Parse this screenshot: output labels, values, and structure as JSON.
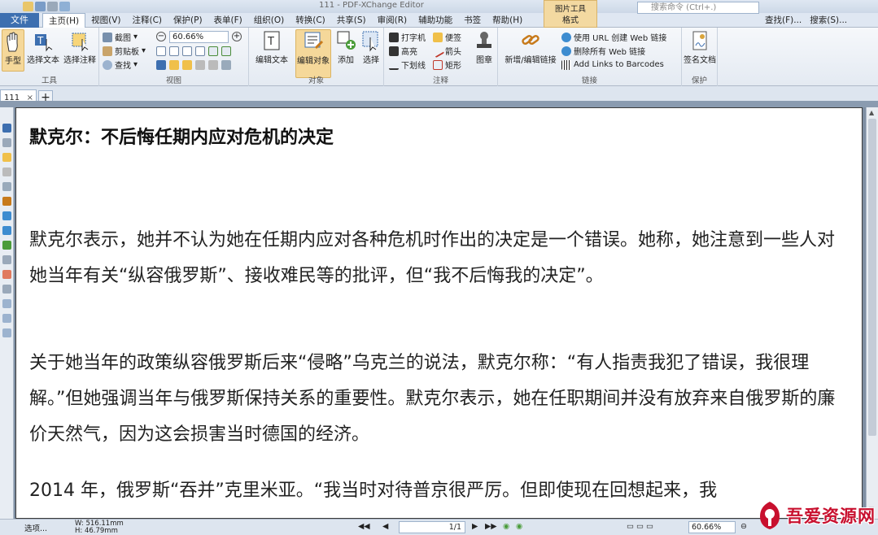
{
  "window": {
    "title": "111 - PDF-XChange Editor"
  },
  "menu": {
    "file": "文件",
    "items": [
      "主页(H)",
      "视图(V)",
      "注释(C)",
      "保护(P)",
      "表单(F)",
      "组织(O)",
      "转换(C)",
      "共享(S)",
      "审阅(R)",
      "辅助功能",
      "书签",
      "帮助(H)"
    ],
    "format_tab_top": "图片工具",
    "format_tab": "格式",
    "search_placeholder": "搜索命令 (Ctrl+.)",
    "right_tools": [
      "查找(F)...",
      "搜索(S)..."
    ]
  },
  "ribbon": {
    "tools_group": {
      "label": "工具",
      "hand": "手型",
      "select_text": "选择文本",
      "select_note": "选择注释"
    },
    "view_group": {
      "label": "视图",
      "snapshot": "截图",
      "clipboard": "剪贴板",
      "find": "查找",
      "zoom": "60.66%"
    },
    "objects_group": {
      "label": "对象",
      "edit_text": "编辑文本",
      "edit_objects": "编辑对象",
      "add": "添加",
      "select": "选择"
    },
    "comments_group": {
      "label": "注释",
      "typewriter": "打字机",
      "sticky": "便签",
      "highlight": "高亮",
      "arrow": "箭头",
      "underline": "下划线",
      "rectangle": "矩形",
      "stamp": "图章"
    },
    "links_group": {
      "label": "链接",
      "new_link": "新增/编辑链接",
      "url_to_links": "使用 URL 创建 Web 链接",
      "remove_links": "删除所有 Web 链接",
      "barcodes": "Add Links to Barcodes"
    },
    "protect_group": {
      "label": "保护",
      "sign": "签名文档"
    }
  },
  "tabs": {
    "doc_name": "111",
    "close": "×",
    "new": "+"
  },
  "document": {
    "heading": "默克尔：不后悔任期内应对危机的决定",
    "paragraphs": [
      "默克尔表示，她并不认为她在任期内应对各种危机时作出的决定是一个错误。她称，她注意到一些人对她当年有关“纵容俄罗斯”、接收难民等的批评，但“我不后悔我的决定”。",
      "关于她当年的政策纵容俄罗斯后来“侵略”乌克兰的说法，默克尔称：“有人指责我犯了错误，我很理解。”但她强调当年与俄罗斯保持关系的重要性。默克尔表示，她在任职期间并没有放弃来自俄罗斯的廉价天然气，因为这会损害当时德国的经济。",
      "2014 年，俄罗斯“吞并”克里米亚。“我当时对待普京很严厉。但即使现在回想起来，我"
    ]
  },
  "statusbar": {
    "options": "选项...",
    "width": "W: 516.11mm",
    "height": "H: 46.79mm",
    "page": "1/1",
    "zoom": "60.66%"
  },
  "watermark": {
    "text": "吾爱资源网"
  },
  "colors": {
    "file_menu": "#3d6fb0",
    "format_tab": "#f3d9a1",
    "watermark": "#c8102e"
  }
}
